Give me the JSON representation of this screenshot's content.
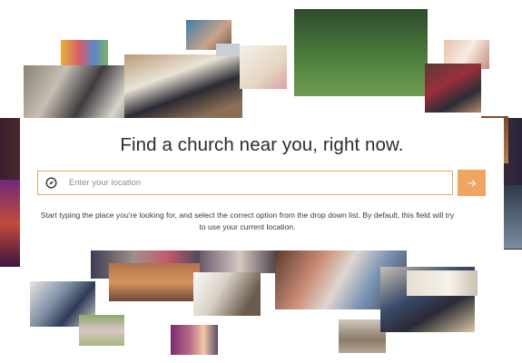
{
  "hero": {
    "headline": "Find a church near you, right now.",
    "location_placeholder": "Enter your location",
    "location_value": "",
    "helper_text": "Start typing the place you're looking for, and select the correct option from the drop down list. By default, this field will try to use your current location."
  },
  "icons": {
    "location_field_icon": "compass-icon",
    "submit_icon": "arrow-right-icon"
  },
  "colors": {
    "accent": "#f0a461",
    "field_border": "#e6a663",
    "text": "#2b2b2b"
  }
}
